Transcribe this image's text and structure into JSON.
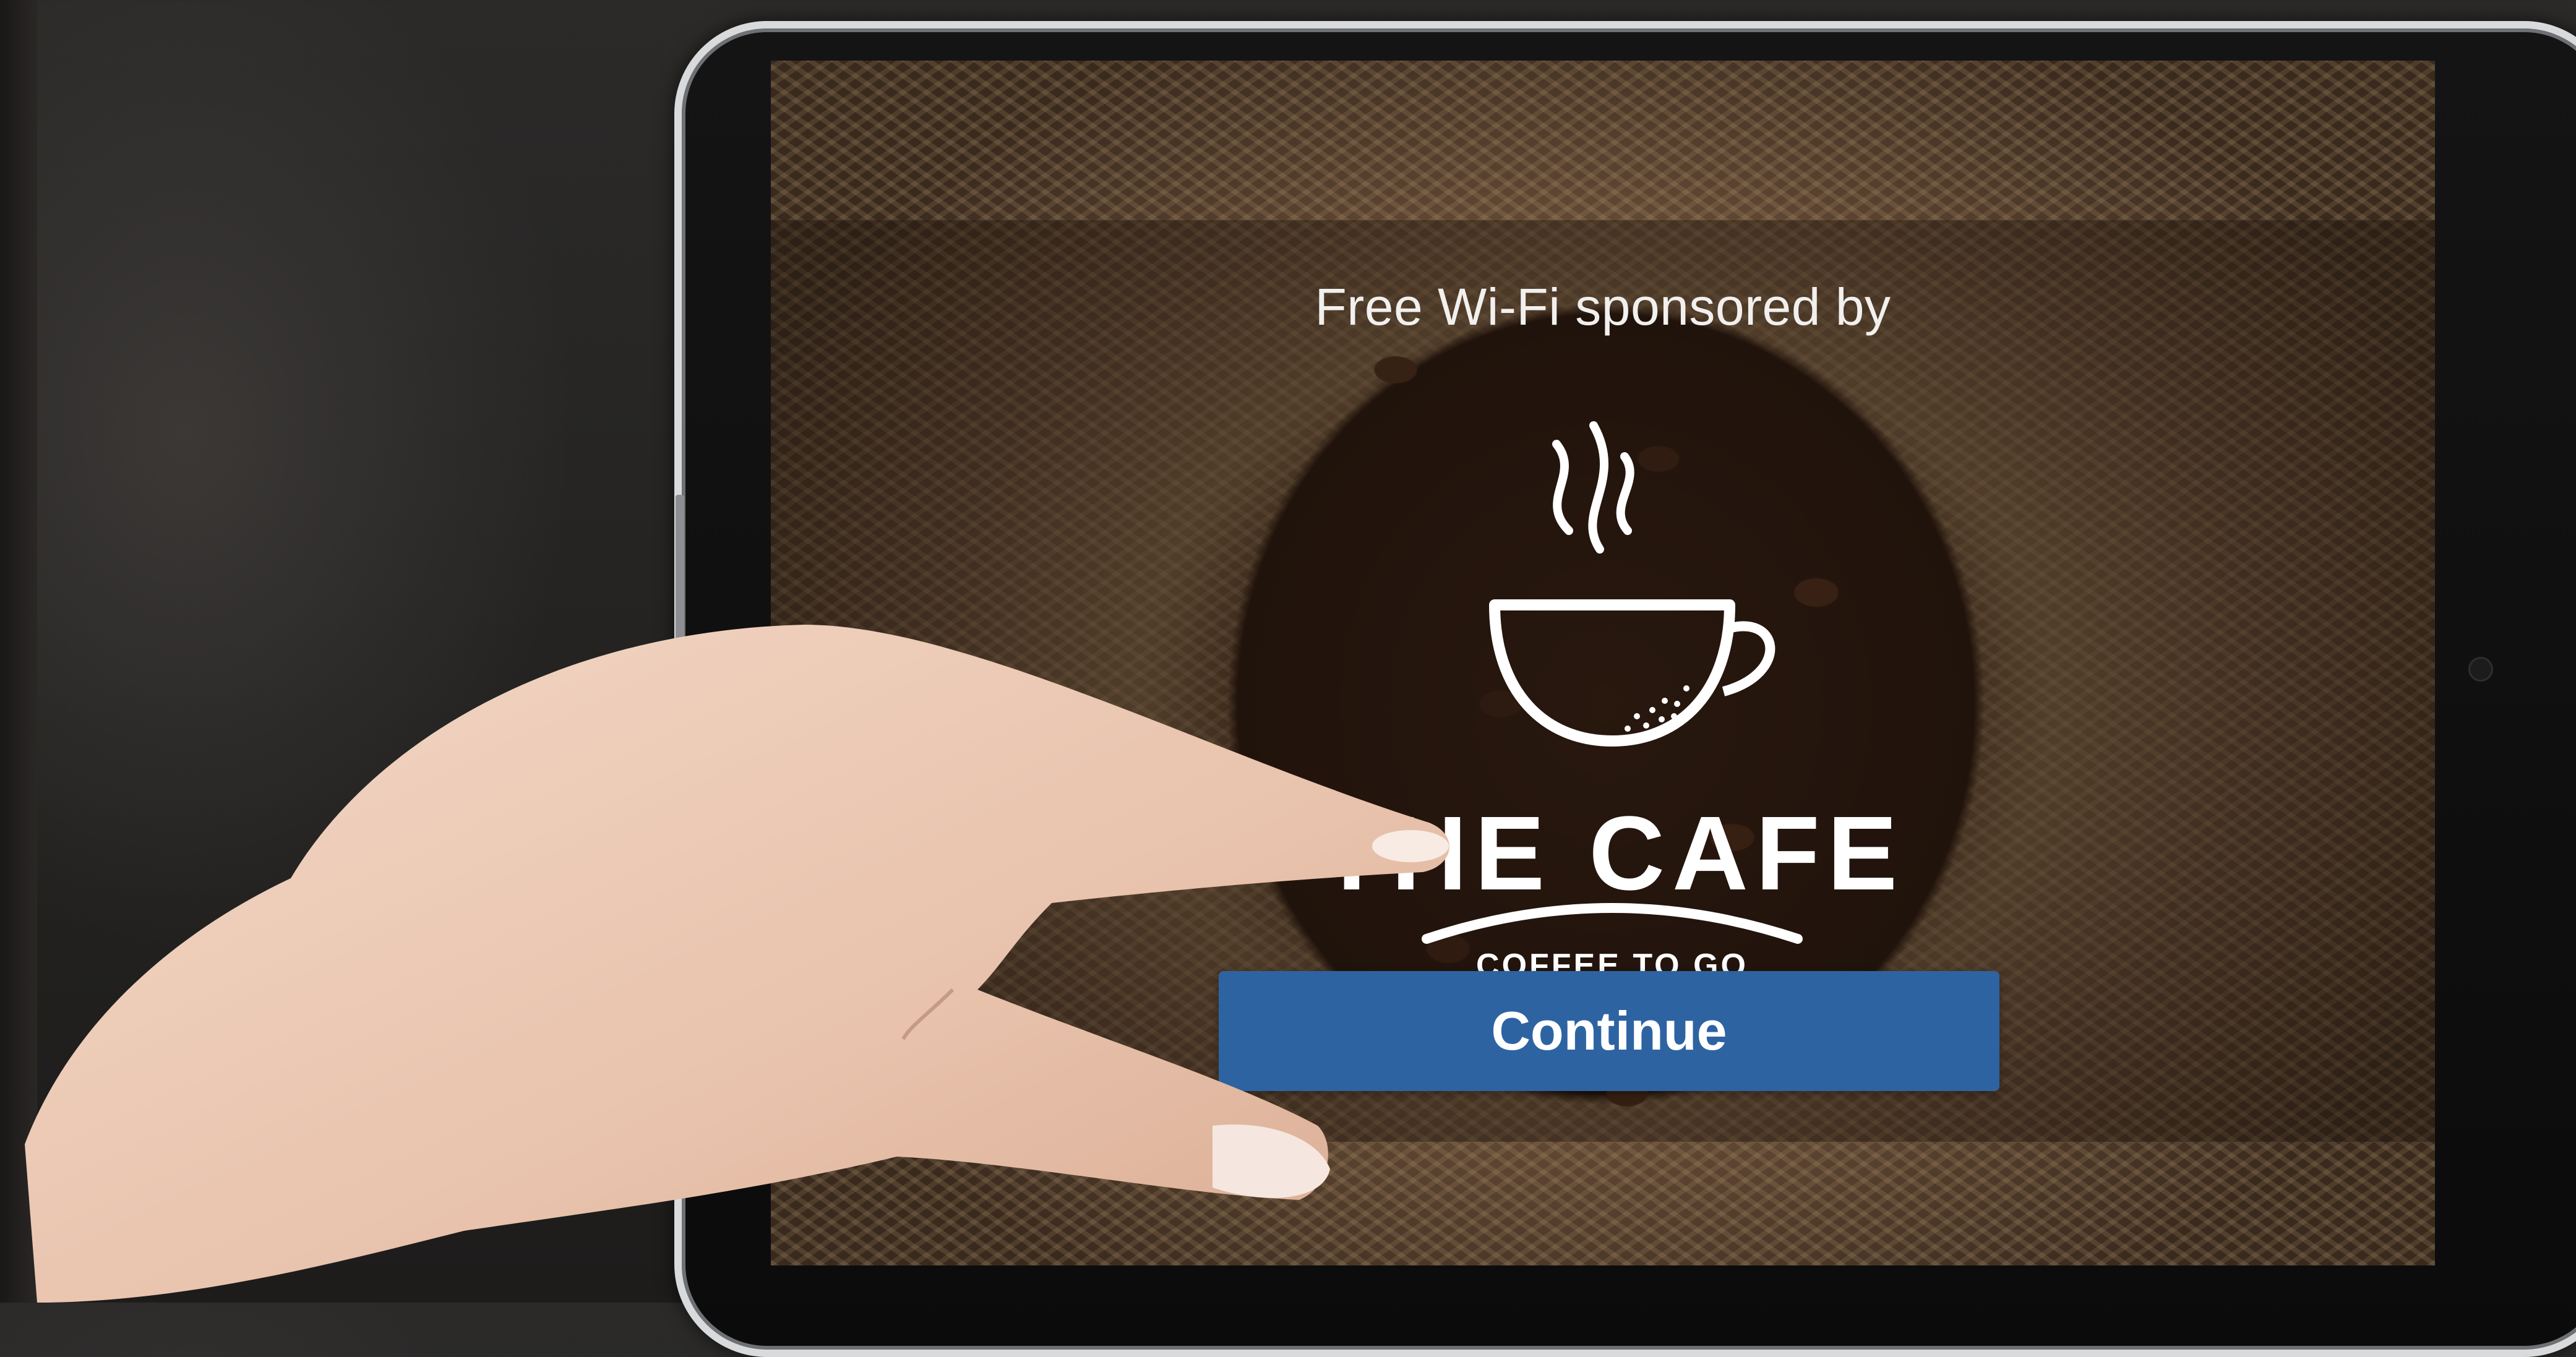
{
  "portal": {
    "sponsor_text": "Free Wi-Fi sponsored by",
    "brand": {
      "name": "THE CAFE",
      "tagline": "COFFEE  TO GO"
    },
    "continue_label": "Continue"
  },
  "colors": {
    "button": "#2e63a2",
    "button_text": "#ffffff",
    "logo": "#ffffff"
  },
  "icons": [
    "coffee-cup-icon",
    "steam-icon"
  ]
}
